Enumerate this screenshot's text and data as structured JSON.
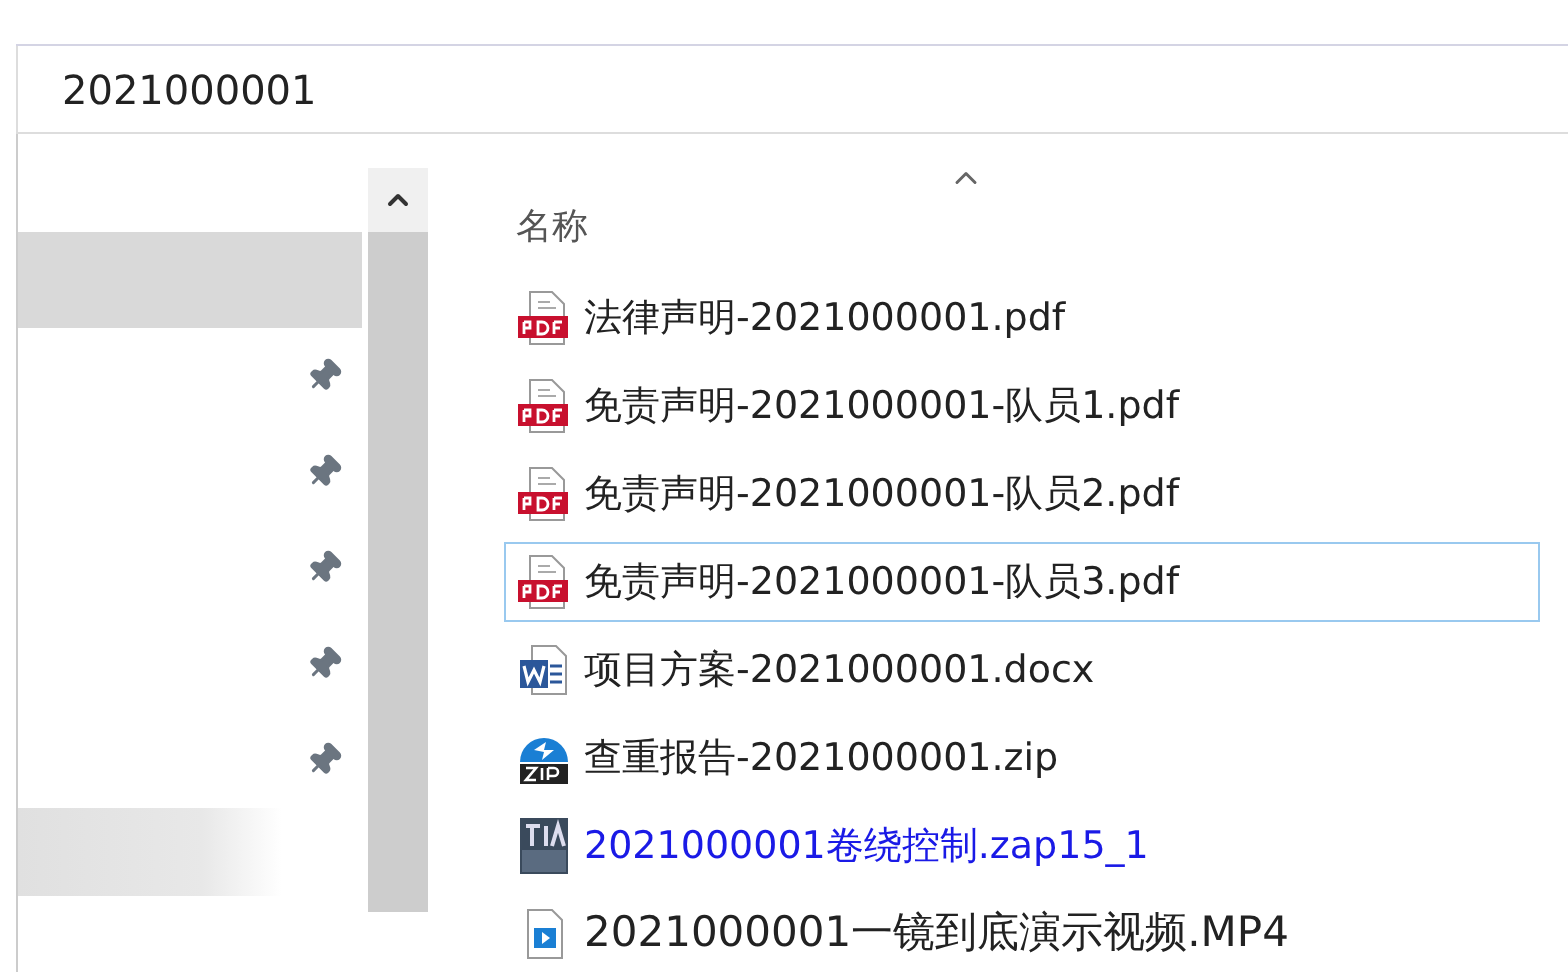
{
  "address_bar": {
    "path": "2021000001"
  },
  "nav_items": [
    {
      "selected": true,
      "pinned": false,
      "hovered": false
    },
    {
      "selected": false,
      "pinned": true,
      "hovered": false
    },
    {
      "selected": false,
      "pinned": true,
      "hovered": false
    },
    {
      "selected": false,
      "pinned": true,
      "hovered": false
    },
    {
      "selected": false,
      "pinned": true,
      "hovered": false
    },
    {
      "selected": false,
      "pinned": true,
      "hovered": false
    },
    {
      "selected": false,
      "pinned": false,
      "hovered": true
    }
  ],
  "file_list": {
    "column_header": "名称",
    "sort_ascending": true,
    "files": [
      {
        "name": "法律声明-2021000001.pdf",
        "kind": "pdf",
        "focused": false,
        "compressed": false
      },
      {
        "name": "免责声明-2021000001-队员1.pdf",
        "kind": "pdf",
        "focused": false,
        "compressed": false
      },
      {
        "name": "免责声明-2021000001-队员2.pdf",
        "kind": "pdf",
        "focused": false,
        "compressed": false
      },
      {
        "name": "免责声明-2021000001-队员3.pdf",
        "kind": "pdf",
        "focused": true,
        "compressed": false
      },
      {
        "name": "项目方案-2021000001.docx",
        "kind": "word",
        "focused": false,
        "compressed": false
      },
      {
        "name": "查重报告-2021000001.zip",
        "kind": "zip",
        "focused": false,
        "compressed": false
      },
      {
        "name": "2021000001卷绕控制.zap15_1",
        "kind": "tia",
        "focused": false,
        "compressed": true
      },
      {
        "name": "2021000001一镜到底演示视频.MP4",
        "kind": "video",
        "focused": false,
        "compressed": false
      }
    ]
  }
}
